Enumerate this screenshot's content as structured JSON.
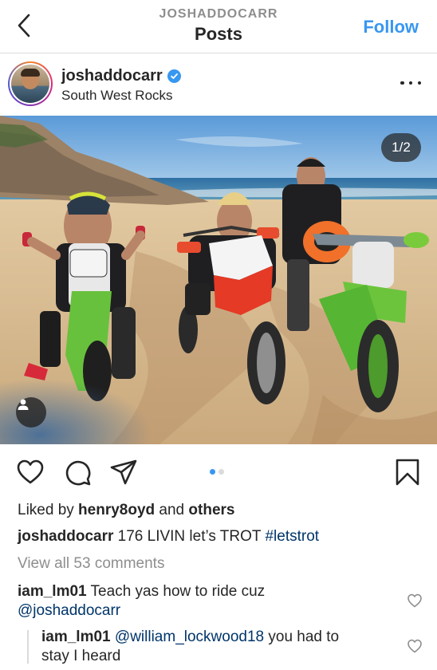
{
  "topbar": {
    "subtitle": "JOSHADDOCARR",
    "title": "Posts",
    "follow_label": "Follow"
  },
  "post": {
    "username": "joshaddocarr",
    "verified": true,
    "location": "South West Rocks",
    "media_counter": "1/2",
    "carousel_index": 1,
    "carousel_total": 2
  },
  "likes": {
    "prefix": "Liked by ",
    "user": "henry8oyd",
    "connector": " and ",
    "others": "others"
  },
  "caption": {
    "user": "joshaddocarr",
    "text": " 176 LIVIN let’s TROT ",
    "hashtag": "#letstrot"
  },
  "view_all_comments": "View all 53 comments",
  "comments": [
    {
      "user": "iam_lm01",
      "text": " Teach yas how to ride cuz",
      "mention": "@joshaddocarr"
    },
    {
      "user": "iam_lm01",
      "mention": "@william_lockwood18",
      "text": " you had to",
      "text2": "stay I heard"
    }
  ],
  "icons": {
    "back": "chevron-left-icon",
    "verified": "verified-badge-icon",
    "more": "more-options-icon",
    "like": "heart-icon",
    "comment": "comment-bubble-icon",
    "share": "paper-plane-icon",
    "save": "bookmark-icon",
    "tags": "person-tag-icon"
  },
  "colors": {
    "accent": "#3897f0",
    "hashtag": "#003569",
    "muted": "#8e8e8e",
    "text": "#262626"
  }
}
